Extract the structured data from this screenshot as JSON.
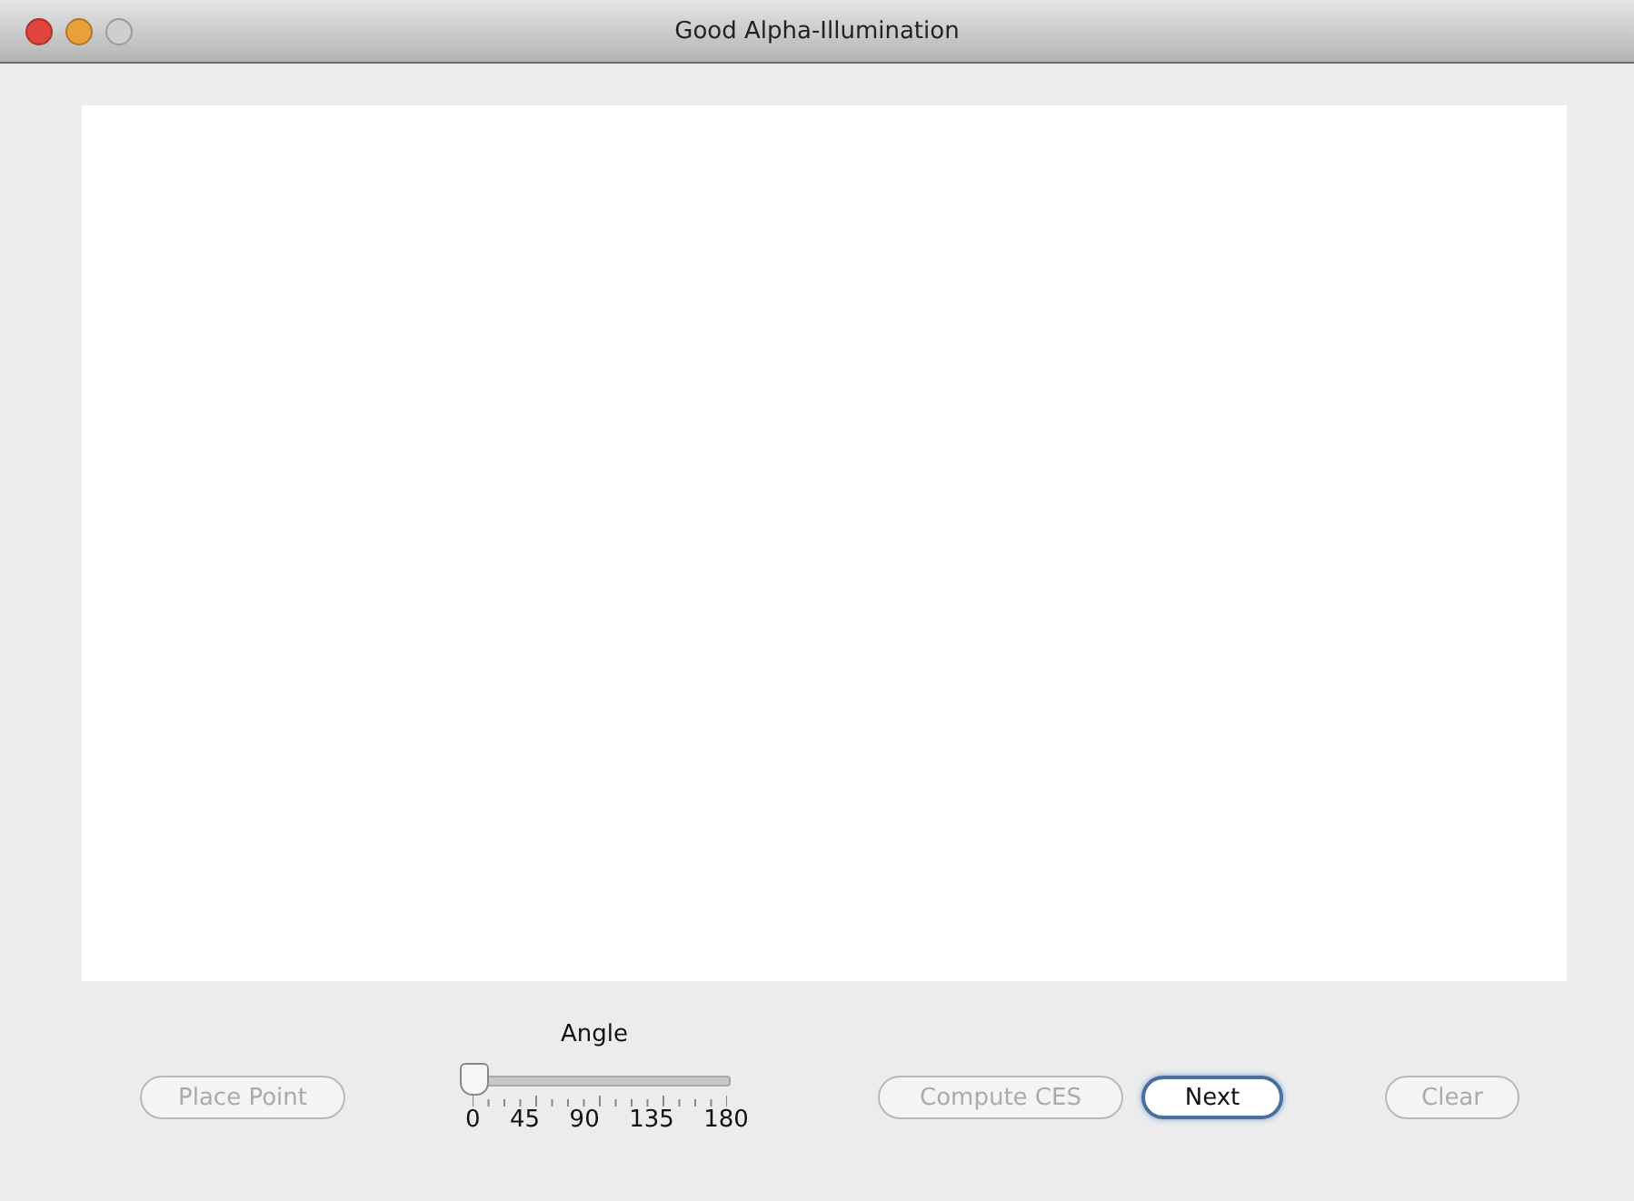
{
  "window": {
    "title": "Good Alpha-Illumination"
  },
  "slider": {
    "label": "Angle",
    "level": 0,
    "tick_labels": [
      "0",
      "45",
      "90",
      "135",
      "180"
    ]
  },
  "buttons": [
    {
      "label": "Place Point",
      "disabled": true,
      "default": false
    },
    {
      "label": "Compute CES",
      "disabled": true,
      "default": false
    },
    {
      "label": "Next",
      "disabled": false,
      "default": true
    },
    {
      "label": "Clear",
      "disabled": true,
      "default": false
    }
  ]
}
